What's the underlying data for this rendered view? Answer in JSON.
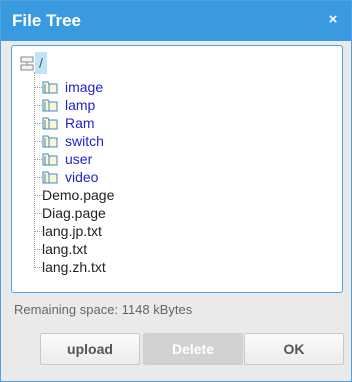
{
  "dialog": {
    "title": "File Tree",
    "close_symbol": "×"
  },
  "tree": {
    "root": "/",
    "folders": [
      {
        "label": "image",
        "icon": "folder-icon"
      },
      {
        "label": "lamp",
        "icon": "folder-icon"
      },
      {
        "label": "Ram",
        "icon": "folder-icon"
      },
      {
        "label": "switch",
        "icon": "folder-icon"
      },
      {
        "label": "user",
        "icon": "folder-icon"
      },
      {
        "label": "video",
        "icon": "folder-icon"
      }
    ],
    "files": [
      {
        "label": "Demo.page"
      },
      {
        "label": "Diag.page"
      },
      {
        "label": "lang.jp.txt"
      },
      {
        "label": "lang.txt"
      },
      {
        "label": "lang.zh.txt"
      }
    ]
  },
  "status": {
    "remaining": "Remaining space: 1148 kBytes"
  },
  "buttons": {
    "upload": "upload",
    "delete": "Delete",
    "ok": "OK"
  },
  "colors": {
    "titlebar": "#3a9ae0",
    "folder_text": "#2222cc",
    "selected_bg": "#bfe3f7"
  }
}
